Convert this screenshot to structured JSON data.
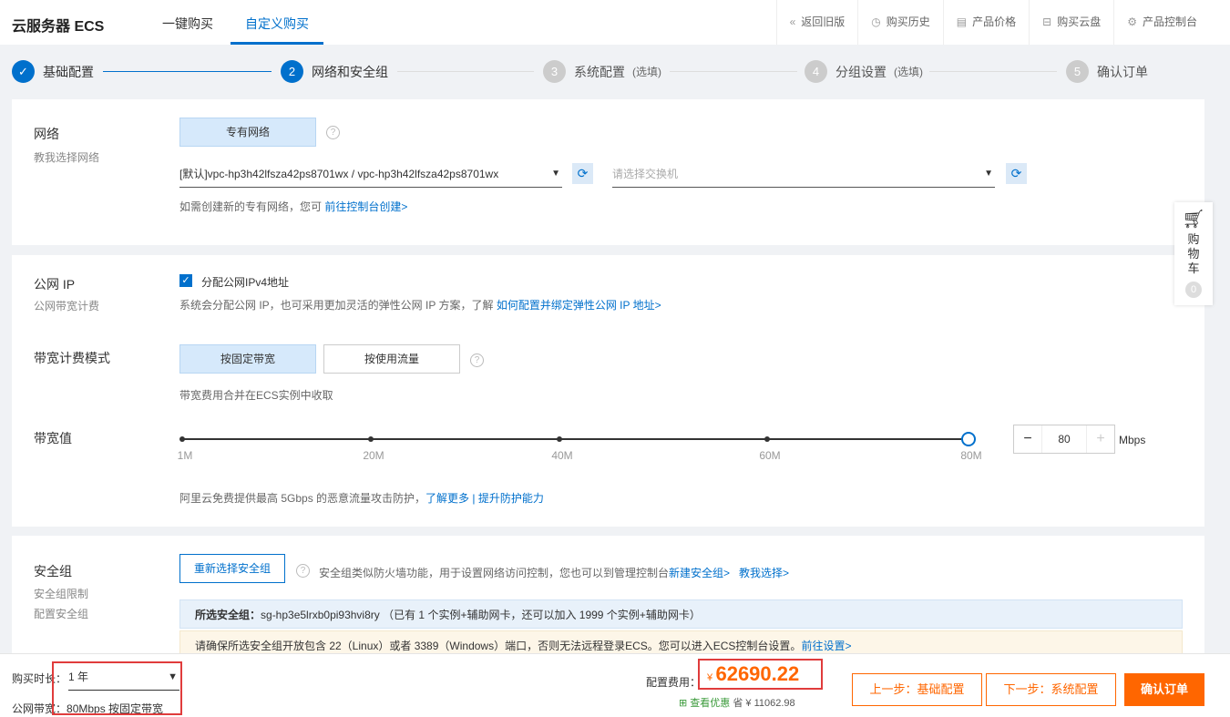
{
  "header": {
    "title": "云服务器 ECS",
    "tabs": [
      {
        "label": "一键购买"
      },
      {
        "label": "自定义购买"
      }
    ],
    "links": [
      {
        "icon": "«",
        "label": "返回旧版"
      },
      {
        "icon": "◷",
        "label": "购买历史"
      },
      {
        "icon": "▤",
        "label": "产品价格"
      },
      {
        "icon": "⊟",
        "label": "购买云盘"
      },
      {
        "icon": "⚙",
        "label": "产品控制台"
      }
    ]
  },
  "steps": [
    {
      "num": "✓",
      "label": "基础配置",
      "opt": ""
    },
    {
      "num": "2",
      "label": "网络和安全组",
      "opt": ""
    },
    {
      "num": "3",
      "label": "系统配置",
      "opt": "(选填)"
    },
    {
      "num": "4",
      "label": "分组设置",
      "opt": "(选填)"
    },
    {
      "num": "5",
      "label": "确认订单",
      "opt": ""
    }
  ],
  "network": {
    "label": "网络",
    "sub": "教我选择网络",
    "type_btn": "专有网络",
    "vpc_value": "[默认]vpc-hp3h42lfsza42ps8701wx / vpc-hp3h42lfsza42ps8701wx",
    "switch_placeholder": "请选择交换机",
    "note": "如需创建新的专有网络，您可",
    "note_link": "前往控制台创建>"
  },
  "public_ip": {
    "label": "公网 IP",
    "sub": "公网带宽计费",
    "checkbox_label": "分配公网IPv4地址",
    "checked": true,
    "note": "系统会分配公网 IP，也可采用更加灵活的弹性公网 IP 方案，了解",
    "note_link": "如何配置并绑定弹性公网 IP 地址>"
  },
  "billing": {
    "label": "带宽计费模式",
    "options": [
      "按固定带宽",
      "按使用流量"
    ],
    "selected": 0,
    "note": "带宽费用合并在ECS实例中收取"
  },
  "bandwidth": {
    "label": "带宽值",
    "ticks": [
      "1M",
      "20M",
      "40M",
      "60M",
      "80M"
    ],
    "value": 80,
    "unit": "Mbps",
    "minus": "−",
    "plus": "+",
    "note": "阿里云免费提供最高 5Gbps 的恶意流量攻击防护，",
    "link1": "了解更多",
    "sep": " | ",
    "link2": "提升防护能力"
  },
  "security": {
    "label": "安全组",
    "sub1": "安全组限制",
    "sub2": "配置安全组",
    "reselect": "重新选择安全组",
    "desc": "安全组类似防火墙功能，用于设置网络访问控制，您也可以到管理控制台",
    "link1": "新建安全组>",
    "link2": "教我选择>",
    "selected_label": "所选安全组：",
    "selected_value": "sg-hp3e5lrxb0pi93hvi8ry （已有 1 个实例+辅助网卡，还可以加入 1999 个实例+辅助网卡）",
    "warning": "请确保所选安全组开放包含 22（Linux）或者 3389（Windows）端口，否则无法远程登录ECS。您可以进入ECS控制台设置。",
    "warning_link": "前往设置>"
  },
  "cart": {
    "label": "购物车",
    "count": "0"
  },
  "footer": {
    "duration_label": "购买时长：",
    "duration_value": "1 年",
    "bandwidth_label": "公网带宽：",
    "bandwidth_value": "80Mbps 按固定带宽",
    "cost_label": "配置费用：",
    "currency": "¥",
    "price": "62690.22",
    "discount_label": "查看优惠",
    "save_label": "省 ¥ 11062.98",
    "prev": "上一步：基础配置",
    "next": "下一步：系统配置",
    "confirm": "确认订单"
  }
}
